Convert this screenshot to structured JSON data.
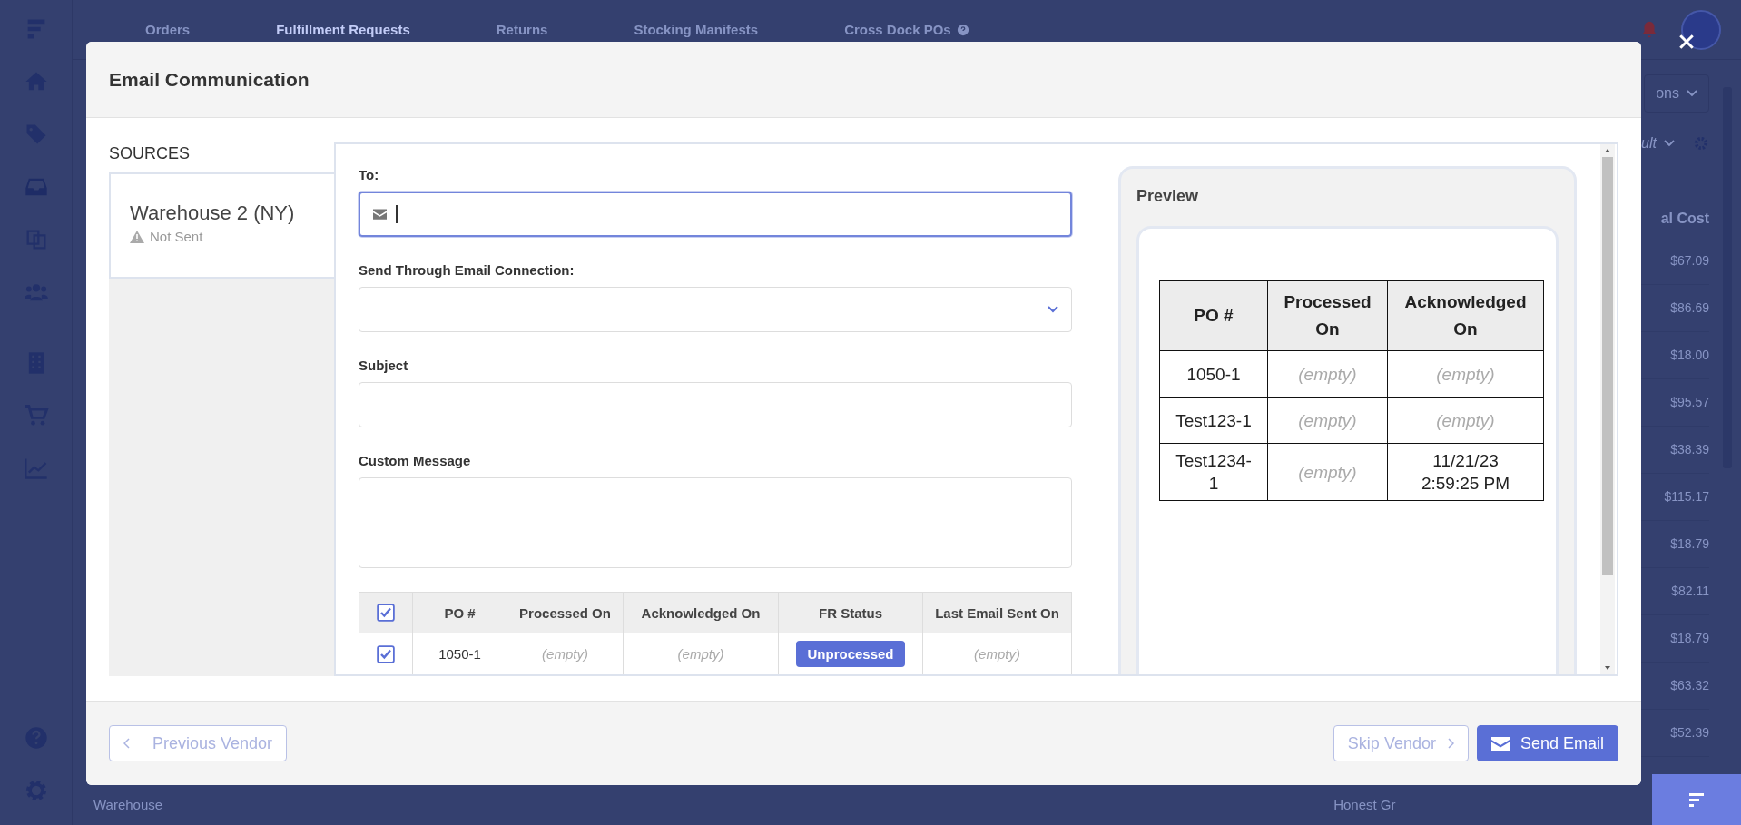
{
  "app_nav": {
    "tabs": [
      {
        "label": "Orders",
        "selected": false
      },
      {
        "label": "Fulfillment Requests",
        "selected": true
      },
      {
        "label": "Returns",
        "selected": false
      },
      {
        "label": "Stocking Manifests",
        "selected": false
      },
      {
        "label": "Cross Dock POs",
        "selected": false,
        "help": true
      }
    ]
  },
  "background_table": {
    "actions_label": "ons",
    "view_label": "ult",
    "column_header": "al Cost",
    "values": [
      "$67.09",
      "$86.69",
      "$18.00",
      "$95.57",
      "$38.39",
      "$115.17",
      "$18.79",
      "$82.11",
      "$18.79",
      "$63.32",
      "$52.39"
    ],
    "bottom_texts": [
      "Warehouse",
      "Honest Gr"
    ]
  },
  "modal": {
    "title": "Email Communication",
    "sources": {
      "heading": "SOURCES",
      "items": [
        {
          "name": "Warehouse 2 (NY)",
          "status": "Not Sent",
          "selected": true
        }
      ]
    },
    "fields": [
      {
        "kind": "email",
        "label": "To:",
        "focused": true
      },
      {
        "kind": "select",
        "label": "Send Through Email Connection:",
        "focused": false
      },
      {
        "kind": "text",
        "label": "Subject",
        "focused": false
      },
      {
        "kind": "textarea",
        "label": "Custom Message",
        "focused": false
      }
    ],
    "po_table": {
      "all_checked": true,
      "columns": [
        "PO #",
        "Processed On",
        "Acknowledged On",
        "FR Status",
        "Last Email Sent On"
      ],
      "rows": [
        {
          "checked": true,
          "cells": [
            {
              "kind": "value",
              "text": "1050-1"
            },
            {
              "kind": "empty",
              "text": "(empty)"
            },
            {
              "kind": "empty",
              "text": "(empty)"
            },
            {
              "kind": "badge",
              "text": "Unprocessed"
            },
            {
              "kind": "empty",
              "text": "(empty)"
            }
          ]
        }
      ]
    },
    "preview": {
      "title": "Preview",
      "columns": [
        "PO #",
        "Processed On",
        "Acknowledged On"
      ],
      "rows": [
        [
          {
            "kind": "value",
            "text": "1050-1"
          },
          {
            "kind": "empty",
            "text": "(empty)"
          },
          {
            "kind": "empty",
            "text": "(empty)"
          }
        ],
        [
          {
            "kind": "value",
            "text": "Test123-1"
          },
          {
            "kind": "empty",
            "text": "(empty)"
          },
          {
            "kind": "empty",
            "text": "(empty)"
          }
        ],
        [
          {
            "kind": "value",
            "text": "Test1234-1"
          },
          {
            "kind": "empty",
            "text": "(empty)"
          },
          {
            "kind": "value",
            "text": "11/21/23 2:59:25 PM"
          }
        ]
      ]
    },
    "buttons": [
      {
        "kind": "back",
        "label": "Previous Vendor",
        "disabled": true
      },
      {
        "kind": "forward",
        "label": "Skip Vendor",
        "disabled": true
      },
      {
        "kind": "send",
        "label": "Send Email",
        "disabled": false
      }
    ]
  }
}
